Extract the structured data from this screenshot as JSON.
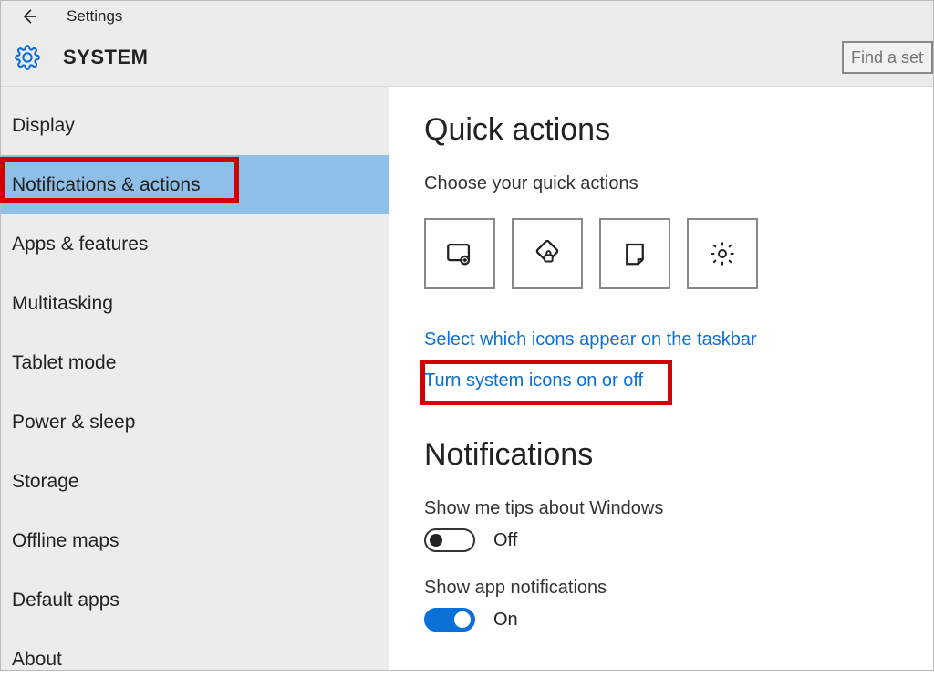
{
  "header": {
    "app_label": "Settings",
    "page_title": "SYSTEM",
    "search_placeholder": "Find a sett"
  },
  "sidebar": {
    "items": [
      {
        "label": "Display"
      },
      {
        "label": "Notifications & actions"
      },
      {
        "label": "Apps & features"
      },
      {
        "label": "Multitasking"
      },
      {
        "label": "Tablet mode"
      },
      {
        "label": "Power & sleep"
      },
      {
        "label": "Storage"
      },
      {
        "label": "Offline maps"
      },
      {
        "label": "Default apps"
      },
      {
        "label": "About"
      }
    ]
  },
  "quick_actions": {
    "heading": "Quick actions",
    "choose_label": "Choose your quick actions",
    "tiles": [
      "tablet-mode-icon",
      "rotation-lock-icon",
      "note-icon",
      "settings-icon"
    ],
    "link_taskbar": "Select which icons appear on the taskbar",
    "link_system_icons": "Turn system icons on or off"
  },
  "notifications": {
    "heading": "Notifications",
    "tips_label": "Show me tips about Windows",
    "tips_state": "Off",
    "app_label": "Show app notifications",
    "app_state": "On"
  }
}
